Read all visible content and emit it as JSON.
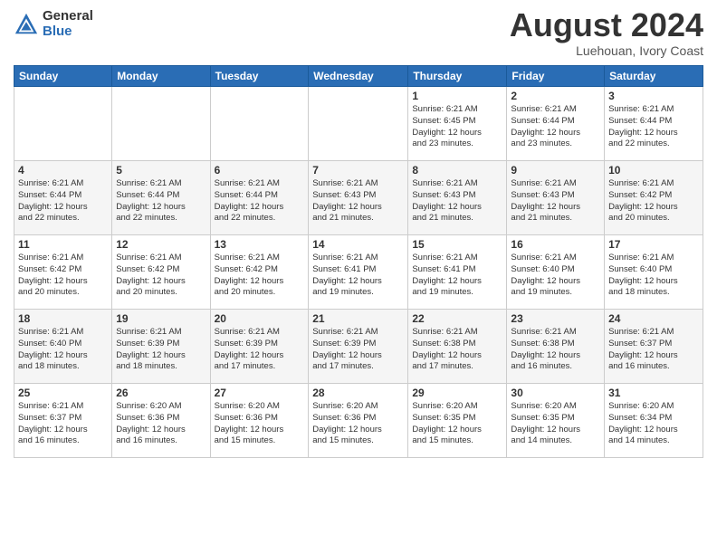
{
  "logo": {
    "general": "General",
    "blue": "Blue"
  },
  "title": {
    "month_year": "August 2024",
    "location": "Luehouan, Ivory Coast"
  },
  "days_of_week": [
    "Sunday",
    "Monday",
    "Tuesday",
    "Wednesday",
    "Thursday",
    "Friday",
    "Saturday"
  ],
  "weeks": [
    [
      {
        "day": "",
        "info": ""
      },
      {
        "day": "",
        "info": ""
      },
      {
        "day": "",
        "info": ""
      },
      {
        "day": "",
        "info": ""
      },
      {
        "day": "1",
        "info": "Sunrise: 6:21 AM\nSunset: 6:45 PM\nDaylight: 12 hours\nand 23 minutes."
      },
      {
        "day": "2",
        "info": "Sunrise: 6:21 AM\nSunset: 6:44 PM\nDaylight: 12 hours\nand 23 minutes."
      },
      {
        "day": "3",
        "info": "Sunrise: 6:21 AM\nSunset: 6:44 PM\nDaylight: 12 hours\nand 22 minutes."
      }
    ],
    [
      {
        "day": "4",
        "info": "Sunrise: 6:21 AM\nSunset: 6:44 PM\nDaylight: 12 hours\nand 22 minutes."
      },
      {
        "day": "5",
        "info": "Sunrise: 6:21 AM\nSunset: 6:44 PM\nDaylight: 12 hours\nand 22 minutes."
      },
      {
        "day": "6",
        "info": "Sunrise: 6:21 AM\nSunset: 6:44 PM\nDaylight: 12 hours\nand 22 minutes."
      },
      {
        "day": "7",
        "info": "Sunrise: 6:21 AM\nSunset: 6:43 PM\nDaylight: 12 hours\nand 21 minutes."
      },
      {
        "day": "8",
        "info": "Sunrise: 6:21 AM\nSunset: 6:43 PM\nDaylight: 12 hours\nand 21 minutes."
      },
      {
        "day": "9",
        "info": "Sunrise: 6:21 AM\nSunset: 6:43 PM\nDaylight: 12 hours\nand 21 minutes."
      },
      {
        "day": "10",
        "info": "Sunrise: 6:21 AM\nSunset: 6:42 PM\nDaylight: 12 hours\nand 20 minutes."
      }
    ],
    [
      {
        "day": "11",
        "info": "Sunrise: 6:21 AM\nSunset: 6:42 PM\nDaylight: 12 hours\nand 20 minutes."
      },
      {
        "day": "12",
        "info": "Sunrise: 6:21 AM\nSunset: 6:42 PM\nDaylight: 12 hours\nand 20 minutes."
      },
      {
        "day": "13",
        "info": "Sunrise: 6:21 AM\nSunset: 6:42 PM\nDaylight: 12 hours\nand 20 minutes."
      },
      {
        "day": "14",
        "info": "Sunrise: 6:21 AM\nSunset: 6:41 PM\nDaylight: 12 hours\nand 19 minutes."
      },
      {
        "day": "15",
        "info": "Sunrise: 6:21 AM\nSunset: 6:41 PM\nDaylight: 12 hours\nand 19 minutes."
      },
      {
        "day": "16",
        "info": "Sunrise: 6:21 AM\nSunset: 6:40 PM\nDaylight: 12 hours\nand 19 minutes."
      },
      {
        "day": "17",
        "info": "Sunrise: 6:21 AM\nSunset: 6:40 PM\nDaylight: 12 hours\nand 18 minutes."
      }
    ],
    [
      {
        "day": "18",
        "info": "Sunrise: 6:21 AM\nSunset: 6:40 PM\nDaylight: 12 hours\nand 18 minutes."
      },
      {
        "day": "19",
        "info": "Sunrise: 6:21 AM\nSunset: 6:39 PM\nDaylight: 12 hours\nand 18 minutes."
      },
      {
        "day": "20",
        "info": "Sunrise: 6:21 AM\nSunset: 6:39 PM\nDaylight: 12 hours\nand 17 minutes."
      },
      {
        "day": "21",
        "info": "Sunrise: 6:21 AM\nSunset: 6:39 PM\nDaylight: 12 hours\nand 17 minutes."
      },
      {
        "day": "22",
        "info": "Sunrise: 6:21 AM\nSunset: 6:38 PM\nDaylight: 12 hours\nand 17 minutes."
      },
      {
        "day": "23",
        "info": "Sunrise: 6:21 AM\nSunset: 6:38 PM\nDaylight: 12 hours\nand 16 minutes."
      },
      {
        "day": "24",
        "info": "Sunrise: 6:21 AM\nSunset: 6:37 PM\nDaylight: 12 hours\nand 16 minutes."
      }
    ],
    [
      {
        "day": "25",
        "info": "Sunrise: 6:21 AM\nSunset: 6:37 PM\nDaylight: 12 hours\nand 16 minutes."
      },
      {
        "day": "26",
        "info": "Sunrise: 6:20 AM\nSunset: 6:36 PM\nDaylight: 12 hours\nand 16 minutes."
      },
      {
        "day": "27",
        "info": "Sunrise: 6:20 AM\nSunset: 6:36 PM\nDaylight: 12 hours\nand 15 minutes."
      },
      {
        "day": "28",
        "info": "Sunrise: 6:20 AM\nSunset: 6:36 PM\nDaylight: 12 hours\nand 15 minutes."
      },
      {
        "day": "29",
        "info": "Sunrise: 6:20 AM\nSunset: 6:35 PM\nDaylight: 12 hours\nand 15 minutes."
      },
      {
        "day": "30",
        "info": "Sunrise: 6:20 AM\nSunset: 6:35 PM\nDaylight: 12 hours\nand 14 minutes."
      },
      {
        "day": "31",
        "info": "Sunrise: 6:20 AM\nSunset: 6:34 PM\nDaylight: 12 hours\nand 14 minutes."
      }
    ]
  ]
}
